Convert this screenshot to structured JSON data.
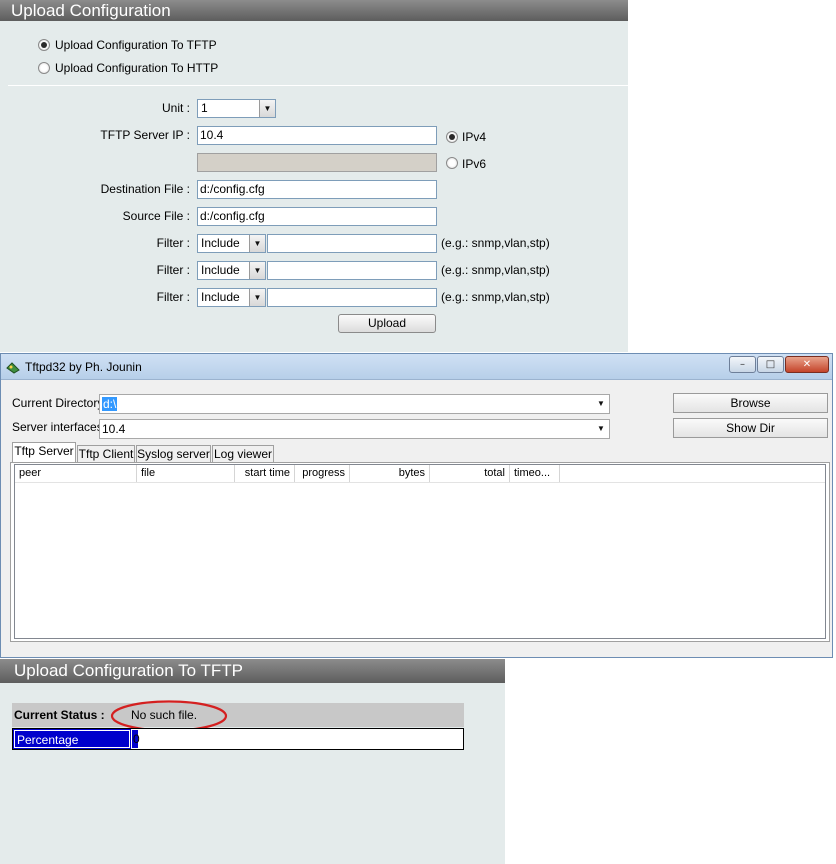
{
  "upload_config": {
    "title": "Upload Configuration",
    "options": [
      {
        "label": "Upload Configuration To TFTP",
        "selected": true
      },
      {
        "label": "Upload Configuration To HTTP",
        "selected": false
      }
    ],
    "unit": {
      "label": "Unit :",
      "value": "1"
    },
    "tftp_server_ip": {
      "label": "TFTP Server IP :",
      "value": "10.4"
    },
    "ip_version": [
      {
        "label": "IPv4",
        "selected": true
      },
      {
        "label": "IPv6",
        "selected": false
      }
    ],
    "destination_file": {
      "label": "Destination File :",
      "value": "d:/config.cfg"
    },
    "source_file": {
      "label": "Source File :",
      "value": "d:/config.cfg"
    },
    "filters": [
      {
        "label": "Filter :",
        "mode": "Include",
        "value": "",
        "hint": "(e.g.: snmp,vlan,stp)"
      },
      {
        "label": "Filter :",
        "mode": "Include",
        "value": "",
        "hint": "(e.g.: snmp,vlan,stp)"
      },
      {
        "label": "Filter :",
        "mode": "Include",
        "value": "",
        "hint": "(e.g.: snmp,vlan,stp)"
      }
    ],
    "upload_button": "Upload"
  },
  "tftpd": {
    "title": "Tftpd32 by Ph. Jounin",
    "current_directory": {
      "label": "Current Directory",
      "value": "d:\\"
    },
    "server_interfaces": {
      "label": "Server interfaces",
      "value": "10.4"
    },
    "browse_button": "Browse",
    "show_dir_button": "Show Dir",
    "tabs": [
      {
        "label": "Tftp Server",
        "active": true
      },
      {
        "label": "Tftp Client",
        "active": false
      },
      {
        "label": "Syslog server",
        "active": false
      },
      {
        "label": "Log viewer",
        "active": false
      }
    ],
    "columns": [
      "peer",
      "file",
      "start time",
      "progress",
      "bytes",
      "total",
      "timeo..."
    ],
    "window_buttons": {
      "minimize": "minimize-icon",
      "maximize": "maximize-icon",
      "close": "close-icon"
    }
  },
  "upload_status": {
    "title": "Upload Configuration To TFTP",
    "status_label": "Current Status :",
    "status_value": "No such file.",
    "percentage_label": "Percentage",
    "percentage_value": "0",
    "highlight_color": "#d42020",
    "accent_color": "#0000cc"
  }
}
